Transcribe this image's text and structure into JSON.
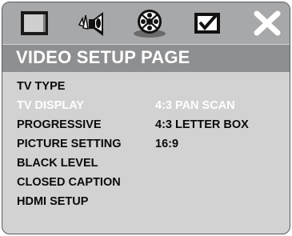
{
  "icons": [
    {
      "name": "general-setup-icon",
      "active": false
    },
    {
      "name": "audio-setup-icon",
      "active": false
    },
    {
      "name": "video-setup-icon",
      "active": true
    },
    {
      "name": "preference-setup-icon",
      "active": false
    },
    {
      "name": "exit-icon",
      "active": false
    }
  ],
  "page": {
    "title": "VIDEO SETUP PAGE"
  },
  "menu": {
    "items": [
      {
        "label": "TV TYPE"
      },
      {
        "label": "TV DISPLAY",
        "selected": true
      },
      {
        "label": "PROGRESSIVE"
      },
      {
        "label": "PICTURE SETTING"
      },
      {
        "label": "BLACK LEVEL"
      },
      {
        "label": "CLOSED CAPTION"
      },
      {
        "label": "HDMI SETUP"
      }
    ]
  },
  "options": {
    "items": [
      {
        "label": "4:3 PAN SCAN",
        "selected": true
      },
      {
        "label": "4:3 LETTER BOX"
      },
      {
        "label": "16:9"
      }
    ]
  },
  "colors": {
    "screen_bg": "#d2d2d3",
    "icon_bar": "#a7a8aa",
    "title_bar": "#8e8f91",
    "highlight_text": "#ffffff",
    "text": "#0a0a0a"
  }
}
